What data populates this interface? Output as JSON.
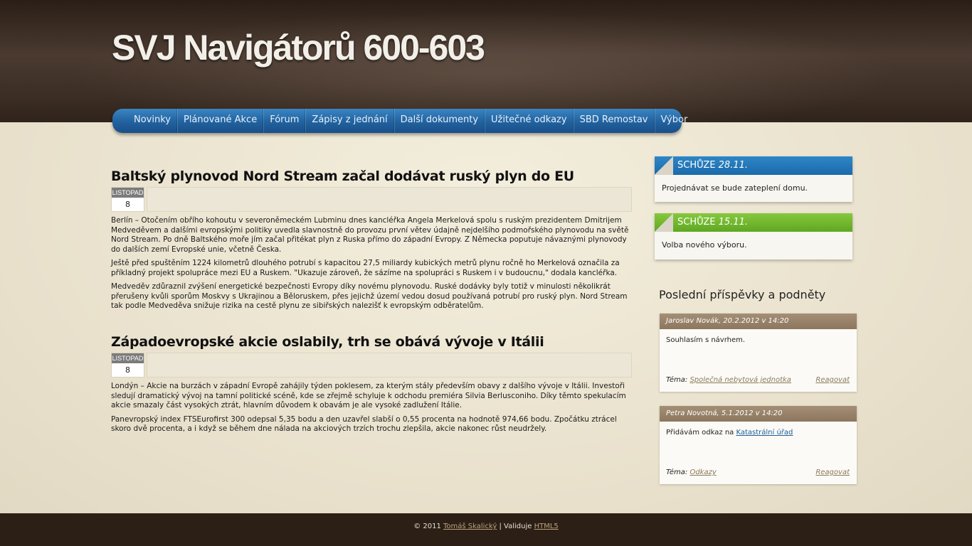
{
  "site": {
    "title": "SVJ Navigátorů 600-603"
  },
  "nav": {
    "items": [
      "Novinky",
      "Plánované Akce",
      "Fórum",
      "Zápisy z jednání",
      "Další dokumenty",
      "Užitečné odkazy",
      "SBD Remostav",
      "Výbor"
    ]
  },
  "articles": [
    {
      "title": "Baltský plynovod Nord Stream začal dodávat ruský plyn do EU",
      "date_month": "LISTOPAD",
      "date_day": "8",
      "paragraphs": [
        "Berlín – Otočením obřího kohoutu v severoněmeckém Lubminu dnes kancléřka Angela Merkelová spolu s ruským prezidentem Dmitrijem Medveděvem a dalšími evropskými politiky uvedla slavnostně do provozu první větev údajně nejdelšího podmořského plynovodu na světě Nord Stream. Po dně Baltského moře jím začal přitékat plyn z Ruska přímo do západní Evropy. Z Německa poputuje návaznými plynovody do dalších zemí Evropské unie, včetně Česka.",
        "Ještě před spuštěním 1224 kilometrů dlouhého potrubí s kapacitou 27,5 miliardy kubických metrů plynu ročně ho Merkelová označila za příkladný projekt spolupráce mezi EU a Ruskem. \"Ukazuje zároveň, že sázíme na spolupráci s Ruskem i v budoucnu,\" dodala kancléřka.",
        "Medveděv zdůraznil zvýšení energetické bezpečnosti Evropy díky novému plynovodu. Ruské dodávky byly totiž v minulosti několikrát přerušeny kvůli sporům Moskvy s Ukrajinou a Běloruskem, přes jejichž území vedou dosud používaná potrubí pro ruský plyn. Nord Stream tak podle Medveděva snižuje rizika na cestě plynu ze sibiřských nalezišť k evropským odběratelům."
      ]
    },
    {
      "title": "Západoevropské akcie oslabily, trh se obává vývoje v Itálii",
      "date_month": "LISTOPAD",
      "date_day": "8",
      "paragraphs": [
        "Londýn – Akcie na burzách v západní Evropě zahájily týden poklesem, za kterým stály především obavy z dalšího vývoje v Itálii. Investoři sledují dramatický vývoj na tamní politické scéně, kde se zřejmě schyluje k odchodu premiéra Silvia Berlusconiho. Díky těmto spekulacím akcie smazaly část vysokých ztrát, hlavním důvodem k obavám je ale vysoké zadlužení Itálie.",
        "Panevropský index FTSEurofirst 300 odepsal 5,35 bodu a den uzavřel slabší o 0,55 procenta na hodnotě 974,66 bodu. Zpočátku ztrácel skoro dvě procenta, a i když se během dne nálada na akciových trzích trochu zlepšila, akcie nakonec růst neudržely."
      ]
    }
  ],
  "sidebar": {
    "meetings": [
      {
        "label": "SCHŮZE",
        "date": "28.11.",
        "text": "Projednávat se bude zateplení domu.",
        "color": "#2277bb"
      },
      {
        "label": "SCHŮZE",
        "date": "15.11.",
        "text": "Volba nového výboru.",
        "color": "#6db52c"
      }
    ],
    "comments_heading": "Poslední příspěvky a podněty",
    "comments": [
      {
        "author_date": "Jaroslav Novák, 20.2.2012 v 14:20",
        "text": "Souhlasím s návrhem.",
        "link_text": "",
        "topic_label": "Téma:",
        "topic": "Společná nebytová jednotka",
        "reply": "Reagovat"
      },
      {
        "author_date": "Petra Novotná, 5.1.2012 v 14:20",
        "text": "Přidávám odkaz na ",
        "link_text": "Katastrální úřad",
        "topic_label": "Téma:",
        "topic": "Odkazy",
        "reply": "Reagovat"
      }
    ]
  },
  "footer": {
    "copyright": "© 2011",
    "author": "Tomáš Skalický",
    "separator": "| Validuje",
    "validator": "HTML5"
  }
}
